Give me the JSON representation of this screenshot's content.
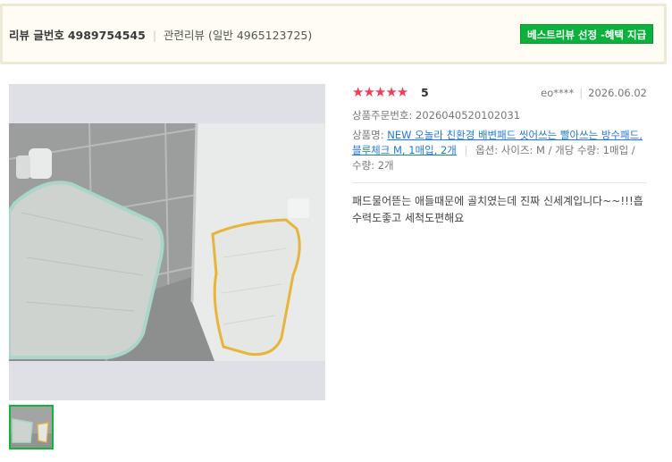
{
  "header": {
    "review_id_label": "리뷰 글번호",
    "review_id": "4989754545",
    "related_label": "관련리뷰 (일반 4965123725)",
    "best_badge": "베스트리뷰 선정 -혜택 지급"
  },
  "review": {
    "stars": "★★★★★",
    "score": "5",
    "reviewer": "eo****",
    "date": "2026.06.02",
    "order_no": "상품주문번호: 2026040520102031",
    "product_label": "상품명:",
    "product_name": "NEW 오놀라 친환경 배변패드 씻어쓰는 빨아쓰는 방수패드, 블루체크 M, 1매입, 2개",
    "option_text": "옵션: 사이즈: M / 개당 수량: 1매입 / 수량: 2개",
    "content": "패드물어뜯는 애들때문에 골치였는데 진짜 신세계입니다~~!!!흡수력도좋고 세척도편해요"
  },
  "colors": {
    "badge": "#0ab23c",
    "stars": "#f53b57",
    "link": "#1e79d8"
  }
}
